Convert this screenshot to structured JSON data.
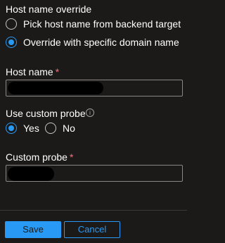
{
  "host_name_override": {
    "label": "Host name override",
    "options": [
      {
        "label": "Pick host name from backend target",
        "selected": false
      },
      {
        "label": "Override with specific domain name",
        "selected": true
      }
    ]
  },
  "host_name": {
    "label": "Host name",
    "required_marker": "*"
  },
  "custom_probe_toggle": {
    "label": "Use custom probe",
    "info_icon": "i",
    "options": [
      {
        "label": "Yes",
        "selected": true
      },
      {
        "label": "No",
        "selected": false
      }
    ]
  },
  "custom_probe": {
    "label": "Custom probe",
    "required_marker": "*"
  },
  "footer": {
    "save_label": "Save",
    "cancel_label": "Cancel"
  },
  "colors": {
    "accent": "#2899f5",
    "background": "#1b1a19",
    "required": "#f1707b"
  }
}
